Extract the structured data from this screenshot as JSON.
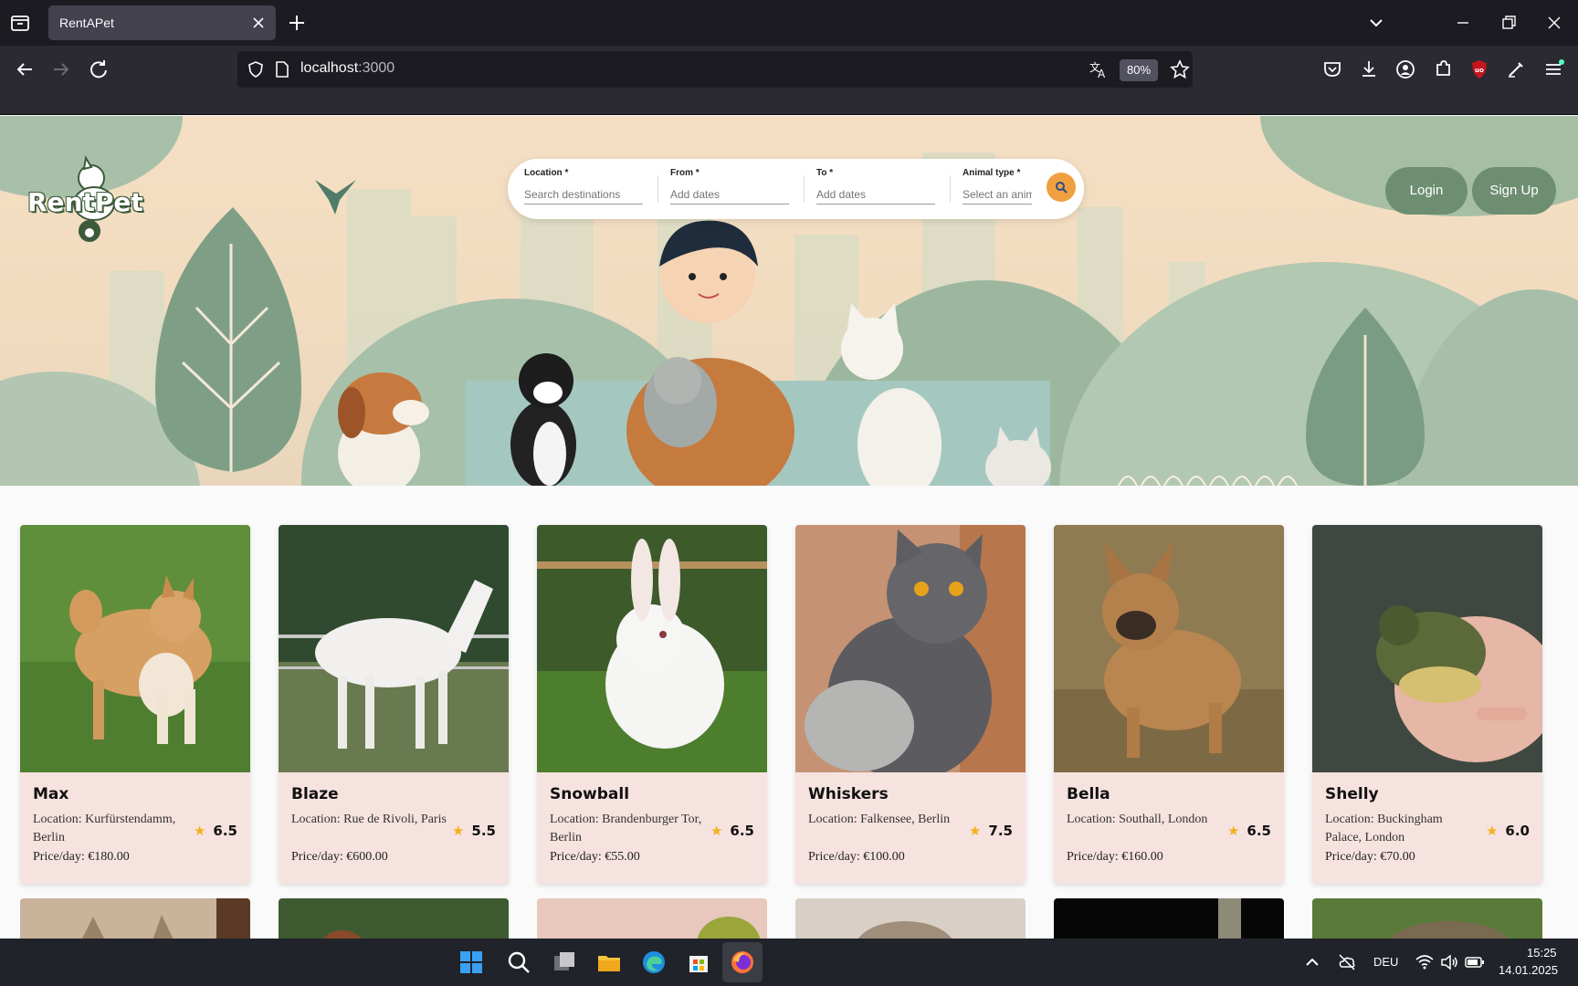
{
  "browser": {
    "tab_title": "RentAPet",
    "url_host": "localhost",
    "url_port": ":3000",
    "zoom": "80%"
  },
  "header": {
    "logo_text": "RentPet",
    "login_label": "Login",
    "signup_label": "Sign Up"
  },
  "search": {
    "location_label": "Location *",
    "location_placeholder": "Search destinations",
    "from_label": "From *",
    "from_placeholder": "Add dates",
    "to_label": "To *",
    "to_placeholder": "Add dates",
    "animal_label": "Animal type *",
    "animal_placeholder": "Select an animal"
  },
  "pets": [
    {
      "name": "Max",
      "location": "Location: Kurfürstendamm, Berlin",
      "price": "Price/day: €180.00",
      "rating": "6.5"
    },
    {
      "name": "Blaze",
      "location": "Location: Rue de Rivoli, Paris",
      "price": "Price/day: €600.00",
      "rating": "5.5"
    },
    {
      "name": "Snowball",
      "location": "Location: Brandenburger Tor, Berlin",
      "price": "Price/day: €55.00",
      "rating": "6.5"
    },
    {
      "name": "Whiskers",
      "location": "Location: Falkensee, Berlin",
      "price": "Price/day: €100.00",
      "rating": "7.5"
    },
    {
      "name": "Bella",
      "location": "Location: Southall, London",
      "price": "Price/day: €160.00",
      "rating": "6.5"
    },
    {
      "name": "Shelly",
      "location": "Location: Buckingham Palace, London",
      "price": "Price/day: €70.00",
      "rating": "6.0"
    }
  ],
  "taskbar": {
    "language": "DEU",
    "time": "15:25",
    "date": "14.01.2025"
  },
  "colors": {
    "accent_orange": "#f0a040",
    "button_green": "#6e8e72",
    "card_bg": "#f6e3e0",
    "star": "#f2b21b"
  }
}
